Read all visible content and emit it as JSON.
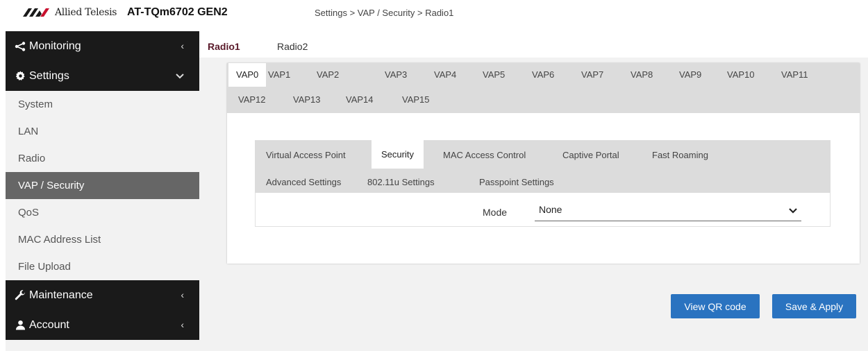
{
  "header": {
    "brand": "Allied Telesis",
    "product": "AT-TQm6702 GEN2",
    "breadcrumb": "Settings > VAP / Security > Radio1"
  },
  "sidebar": {
    "monitoring": "Monitoring",
    "settings": "Settings",
    "settings_items": [
      "System",
      "LAN",
      "Radio",
      "VAP / Security",
      "QoS",
      "MAC Address List",
      "File Upload"
    ],
    "active_item": "VAP / Security",
    "maintenance": "Maintenance",
    "account": "Account"
  },
  "radio_tabs": [
    "Radio1",
    "Radio2"
  ],
  "vap_tabs": [
    "VAP0",
    "VAP1",
    "VAP2",
    "VAP3",
    "VAP4",
    "VAP5",
    "VAP6",
    "VAP7",
    "VAP8",
    "VAP9",
    "VAP10",
    "VAP11",
    "VAP12",
    "VAP13",
    "VAP14",
    "VAP15"
  ],
  "security_tabs": [
    "Virtual Access Point",
    "Security",
    "MAC Access Control",
    "Captive Portal",
    "Fast Roaming",
    "Advanced Settings",
    "802.11u Settings",
    "Passpoint Settings"
  ],
  "mode": {
    "label": "Mode",
    "value": "None"
  },
  "buttons": {
    "view_qr": "View QR code",
    "save_apply": "Save & Apply"
  },
  "colors": {
    "accent": "#2a73c0",
    "nav_dark": "#1a1a1a",
    "active_sub": "#666666",
    "radio_active": "#5a1a2a"
  }
}
